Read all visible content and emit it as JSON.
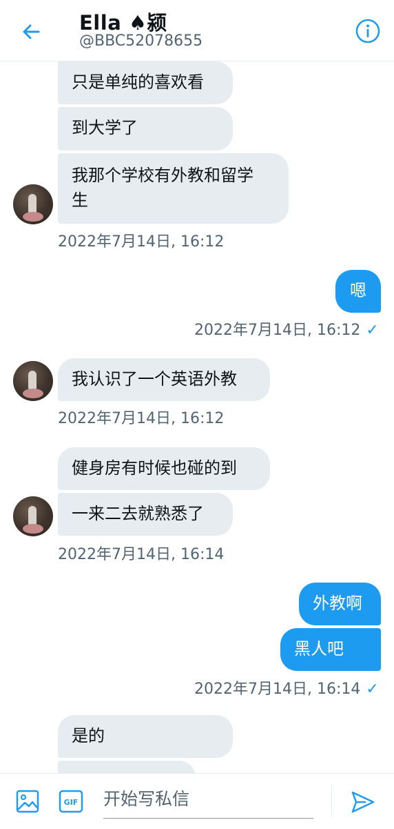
{
  "header": {
    "title": "Ella ♠颍",
    "handle": "@BBC52078655"
  },
  "messages": [
    {
      "text": "只是单纯的喜欢看"
    },
    {
      "text": "到大学了"
    },
    {
      "text": "我那个学校有外教和留学"
    },
    {
      "text": "生"
    },
    {
      "text": "嗯"
    },
    {
      "text": "我认识了一个英语外教"
    },
    {
      "text": "健身房有时候也碰的到"
    },
    {
      "text": "一来二去就熟悉了"
    },
    {
      "text": "外教啊"
    },
    {
      "text": "黑人吧"
    },
    {
      "text": "是的"
    }
  ],
  "timestamps": {
    "t1": "2022年7月14日, 16:12",
    "t2": "2022年7月14日, 16:12",
    "t3": "2022年7月14日, 16:12",
    "t4": "2022年7月14日, 16:14",
    "t5": "2022年7月14日, 16:14"
  },
  "composer": {
    "placeholder": "开始写私信",
    "gif_label": "GIF"
  },
  "colors": {
    "accent": "#1d9bf0",
    "incoming_bubble": "#e7ecf0",
    "muted_text": "#536471"
  },
  "icons": [
    "back-arrow-icon",
    "info-icon",
    "image-icon",
    "gif-icon",
    "send-icon",
    "read-check-icon"
  ]
}
